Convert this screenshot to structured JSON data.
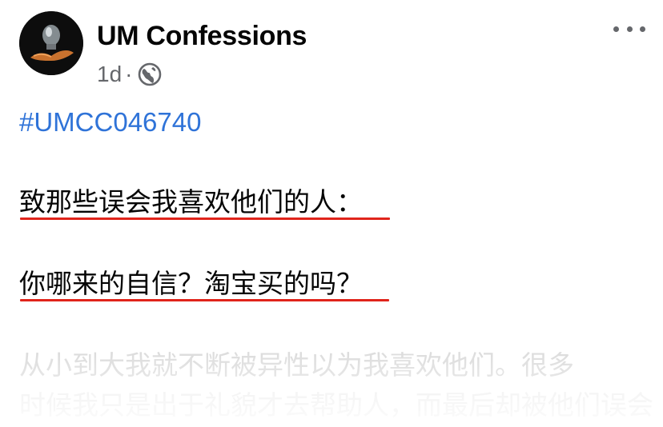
{
  "post": {
    "page_name": "UM Confessions",
    "time": "1d",
    "separator": "·",
    "visibility_icon": "globe-icon",
    "more_icon": "more-horizontal-icon",
    "hashtag": "#UMCC046740",
    "lines": [
      "致那些误会我喜欢他们的人：",
      "你哪来的自信？淘宝买的吗？"
    ],
    "faded_lines": [
      "从小到大我就不断被异性以为我喜欢他们。很多",
      "时候我只是出于礼貌才去帮助人，而最后却被他们误会"
    ]
  },
  "colors": {
    "hashtag": "#2f73d8",
    "underline": "#e0241b",
    "meta": "#65676b",
    "text": "#050505"
  }
}
